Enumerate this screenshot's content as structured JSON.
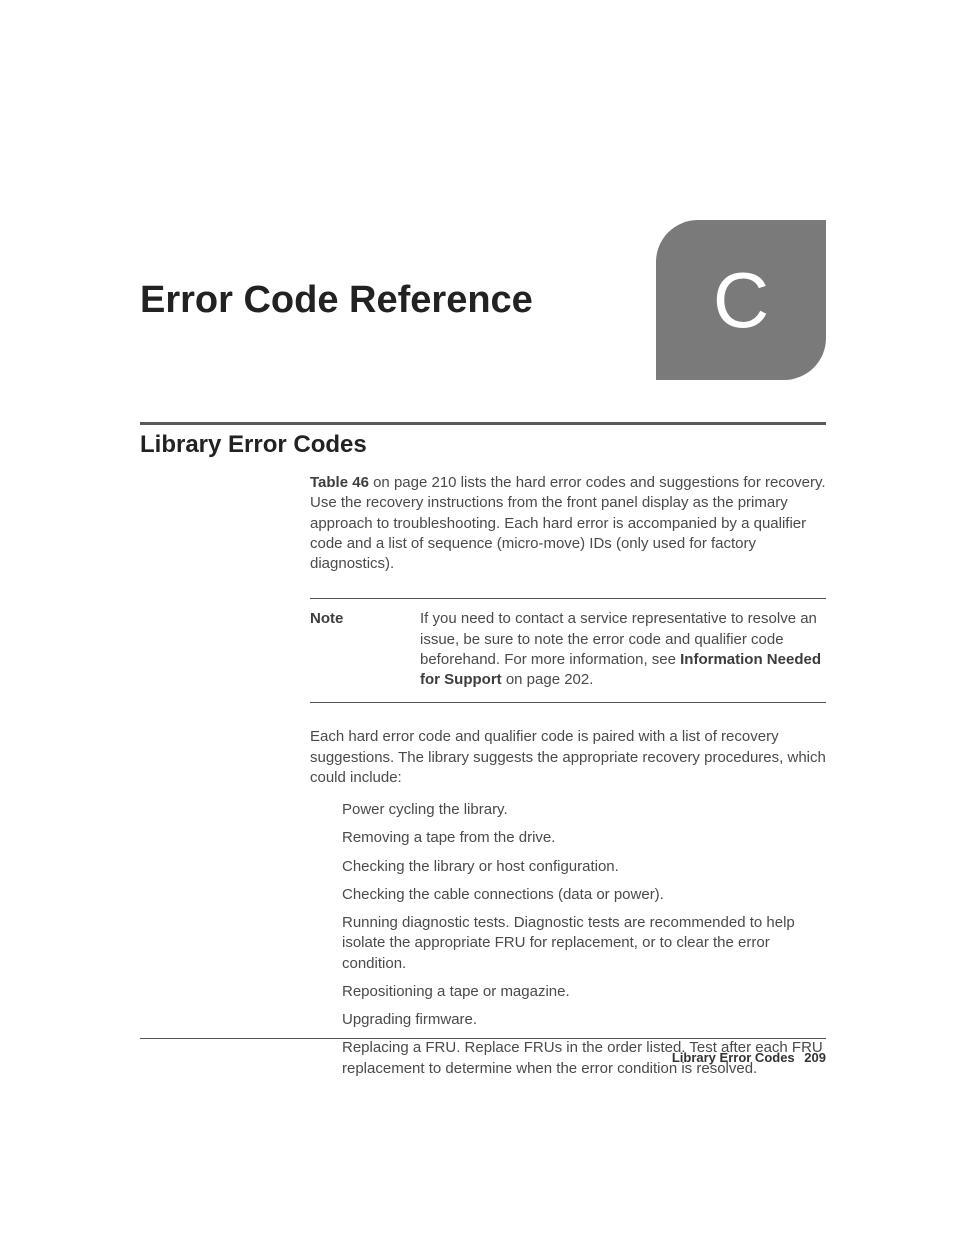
{
  "page": {
    "title": "Error Code Reference",
    "appendix_letter": "C"
  },
  "section": {
    "heading": "Library Error Codes",
    "intro_ref": "Table 46",
    "intro_text": " on page 210 lists the hard error codes and suggestions for recovery. Use the recovery instructions from the front panel display as the primary approach to troubleshooting. Each hard error is accompanied by a qualifier code and a list of sequence (micro-move) IDs (only used for factory diagnostics)."
  },
  "note": {
    "label": "Note",
    "text_pre": "If you need to contact a service representative to resolve an issue, be sure to note the error code and qualifier code beforehand. For more information, see ",
    "link": "Information Needed for Support",
    "text_post": " on page 202."
  },
  "body": {
    "para": "Each hard error code and qualifier code is paired with a list of recovery suggestions. The library suggests the appropriate recovery procedures, which could include:",
    "items": [
      "Power cycling the library.",
      "Removing a tape from the drive.",
      "Checking the library or host configuration.",
      "Checking the cable connections (data or power).",
      "Running diagnostic tests. Diagnostic tests are recommended to help isolate the appropriate FRU for replacement, or to clear the error condition.",
      "Repositioning a tape or magazine.",
      "Upgrading firmware.",
      "Replacing a FRU. Replace FRUs in the order listed. Test after each FRU replacement to determine when the error condition is resolved."
    ]
  },
  "footer": {
    "title": "Library Error Codes",
    "page": "209"
  }
}
